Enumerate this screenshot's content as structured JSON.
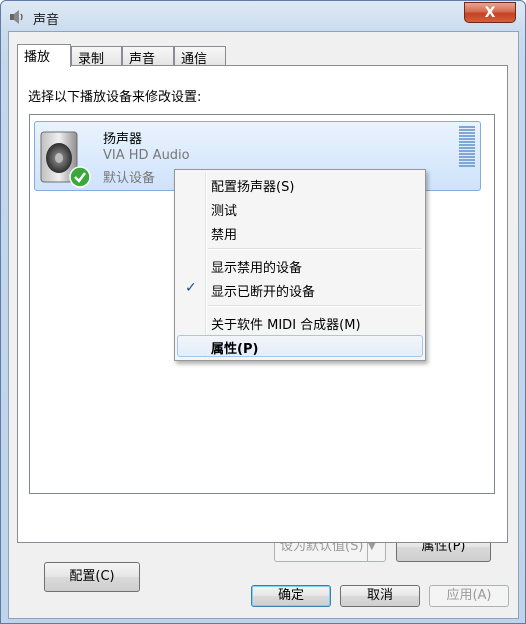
{
  "window": {
    "title": "声音",
    "close_label": "X"
  },
  "tabs": [
    {
      "label": "播放",
      "active": true
    },
    {
      "label": "录制",
      "active": false
    },
    {
      "label": "声音",
      "active": false
    },
    {
      "label": "通信",
      "active": false
    }
  ],
  "panel": {
    "instruction": "选择以下播放设备来修改设置:"
  },
  "device": {
    "name": "扬声器",
    "driver": "VIA HD Audio",
    "status": "默认设备",
    "icon": "speaker-icon",
    "status_icon": "check-badge-icon"
  },
  "context_menu": {
    "items": [
      {
        "label": "配置扬声器(S)"
      },
      {
        "label": "测试"
      },
      {
        "label": "禁用"
      },
      {
        "label": "显示禁用的设备"
      },
      {
        "label": "显示已断开的设备",
        "checked": true
      },
      {
        "label": "关于软件 MIDI 合成器(M)"
      },
      {
        "label": "属性(P)",
        "highlighted": true
      }
    ]
  },
  "buttons": {
    "configure": "配置(C)",
    "set_default": "设为默认值(S)",
    "properties": "属性(P)",
    "ok": "确定",
    "cancel": "取消",
    "apply": "应用(A)"
  },
  "colors": {
    "selection_border": "#84acdd",
    "menu_highlight_border": "#a8c6ea",
    "close_button": "#c6401f"
  }
}
